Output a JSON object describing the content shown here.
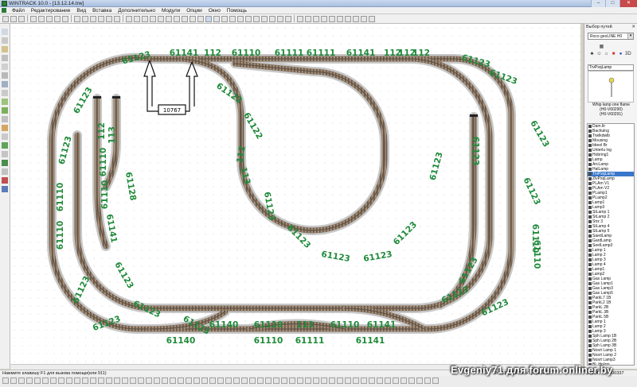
{
  "window": {
    "title": "WINTRACK 10.0 - [13.12.14.trw]",
    "minimize": "–",
    "maximize": "□",
    "close": "✕"
  },
  "menu": [
    "Файл",
    "Редактирование",
    "Вид",
    "Вставка",
    "Дополнительно",
    "Модули",
    "Опции",
    "Окно",
    "Помощь"
  ],
  "track_panel": {
    "title": "Выбор путей",
    "close": "✕",
    "library": "Roco geoLINE H0",
    "selected_name": "TrvPsqLamp",
    "description_line1": "Whip lamp one flame",
    "description_line2": "(H0-V60290)",
    "description_line3": "(H0-V60291)",
    "items": [
      "Dam.ltr",
      "Bachulng",
      "Trwlkdwlb",
      "Mousing",
      "bbeel Br",
      "Unterlu lvg",
      "Hobring1",
      "Lamp",
      "ArcLamp",
      "HalLamp",
      "TrvPsqLamp",
      "ZlvPsqLamp",
      "PLAm V1",
      "PLAm V2",
      "PLamp1",
      "PLamp2",
      "Lamp1",
      "Lamp3",
      "StLamp 1",
      "StLamp 2",
      "Strz 3",
      "StLamp 4",
      "StLamp 5",
      "SaedLamp",
      "GardLamp",
      "SeelLamp3",
      "Lamp 1",
      "Lamp 2",
      "Lamp 3",
      "Lamp 4",
      "Lamp1",
      "Lamp2",
      "Gas Lamp",
      "Gas Lamp1",
      "Gas Lamp3",
      "Gas Lamp5",
      "ParkL7 1B",
      "ParkL2 1B",
      "ParkL 2B",
      "ParkL 3B",
      "ParkL 5B",
      "Lamp 1",
      "Lamp 2",
      "Lamp 3",
      "Sph Lamp 1B",
      "Sph Lamp 2B",
      "Sph Lamp 3B",
      "Nosrt Lamp 1",
      "Nosrt Lamp 2",
      "Nosrt Lamp3",
      "BL Holzm",
      "Lat Lamp1",
      "Lat Lamp2",
      "Lat Lamp3",
      "Lat Lamp4",
      "x5",
      "x6"
    ],
    "selected_index": 10
  },
  "status": {
    "hint": "Нажмите клавишу F1 для вызова помощи(или 911)",
    "track_info": "Ro61122/187mm/Уровень 10",
    "coord_x": "-01124",
    "coord_y": "+00337"
  },
  "watermark": "Evgeniy71 для forum.onliner.by",
  "layout": {
    "dimension_label": "10767",
    "track_labels": [
      {
        "text": "61123",
        "rot": -15
      },
      {
        "text": "61141",
        "rot": 0
      },
      {
        "text": "112",
        "rot": 0
      },
      {
        "text": "61110",
        "rot": 0
      },
      {
        "text": "61111",
        "rot": 0
      },
      {
        "text": "61111",
        "rot": 0
      },
      {
        "text": "61141",
        "rot": 0
      },
      {
        "text": "112",
        "rot": 0
      },
      {
        "text": "112",
        "rot": 0
      },
      {
        "text": "112",
        "rot": 0
      },
      {
        "text": "61123",
        "rot": 15
      },
      {
        "text": "61123",
        "rot": -60
      },
      {
        "text": "61123",
        "rot": -75
      },
      {
        "text": "61110",
        "rot": -90
      },
      {
        "text": "61110",
        "rot": -90
      },
      {
        "text": "61123",
        "rot": 60
      },
      {
        "text": "61123",
        "rot": 20
      },
      {
        "text": "61123",
        "rot": 65
      },
      {
        "text": "61110",
        "rot": 90
      },
      {
        "text": "61110",
        "rot": 90
      },
      {
        "text": "61123",
        "rot": -65
      },
      {
        "text": "61123",
        "rot": -20
      },
      {
        "text": "61122",
        "rot": 35
      },
      {
        "text": "61122",
        "rot": 60
      },
      {
        "text": "112",
        "rot": -80
      },
      {
        "text": "113",
        "rot": 75
      },
      {
        "text": "61123",
        "rot": 80
      },
      {
        "text": "61123",
        "rot": 45
      },
      {
        "text": "61123",
        "rot": 10
      },
      {
        "text": "61123",
        "rot": -10
      },
      {
        "text": "61123",
        "rot": -45
      },
      {
        "text": "61123",
        "rot": -75
      },
      {
        "text": "61123",
        "rot": 90
      },
      {
        "text": "112",
        "rot": -90
      },
      {
        "text": "113",
        "rot": -90
      },
      {
        "text": "61110",
        "rot": -90
      },
      {
        "text": "61110",
        "rot": -90
      },
      {
        "text": "61128",
        "rot": 80
      },
      {
        "text": "61141",
        "rot": 80
      },
      {
        "text": "61123",
        "rot": 60
      },
      {
        "text": "61123",
        "rot": 25
      },
      {
        "text": "61123",
        "rot": -25
      },
      {
        "text": "61123",
        "rot": -60
      },
      {
        "text": "61123",
        "rot": 30
      },
      {
        "text": "61140",
        "rot": 0
      },
      {
        "text": "61110",
        "rot": 0
      },
      {
        "text": "113",
        "rot": 0
      },
      {
        "text": "61110",
        "rot": 0
      },
      {
        "text": "61141",
        "rot": 0
      },
      {
        "text": "61123",
        "rot": -25
      },
      {
        "text": "61140",
        "rot": 0
      },
      {
        "text": "61110",
        "rot": 0
      },
      {
        "text": "61111",
        "rot": 0
      },
      {
        "text": "61141",
        "rot": 0
      }
    ]
  }
}
